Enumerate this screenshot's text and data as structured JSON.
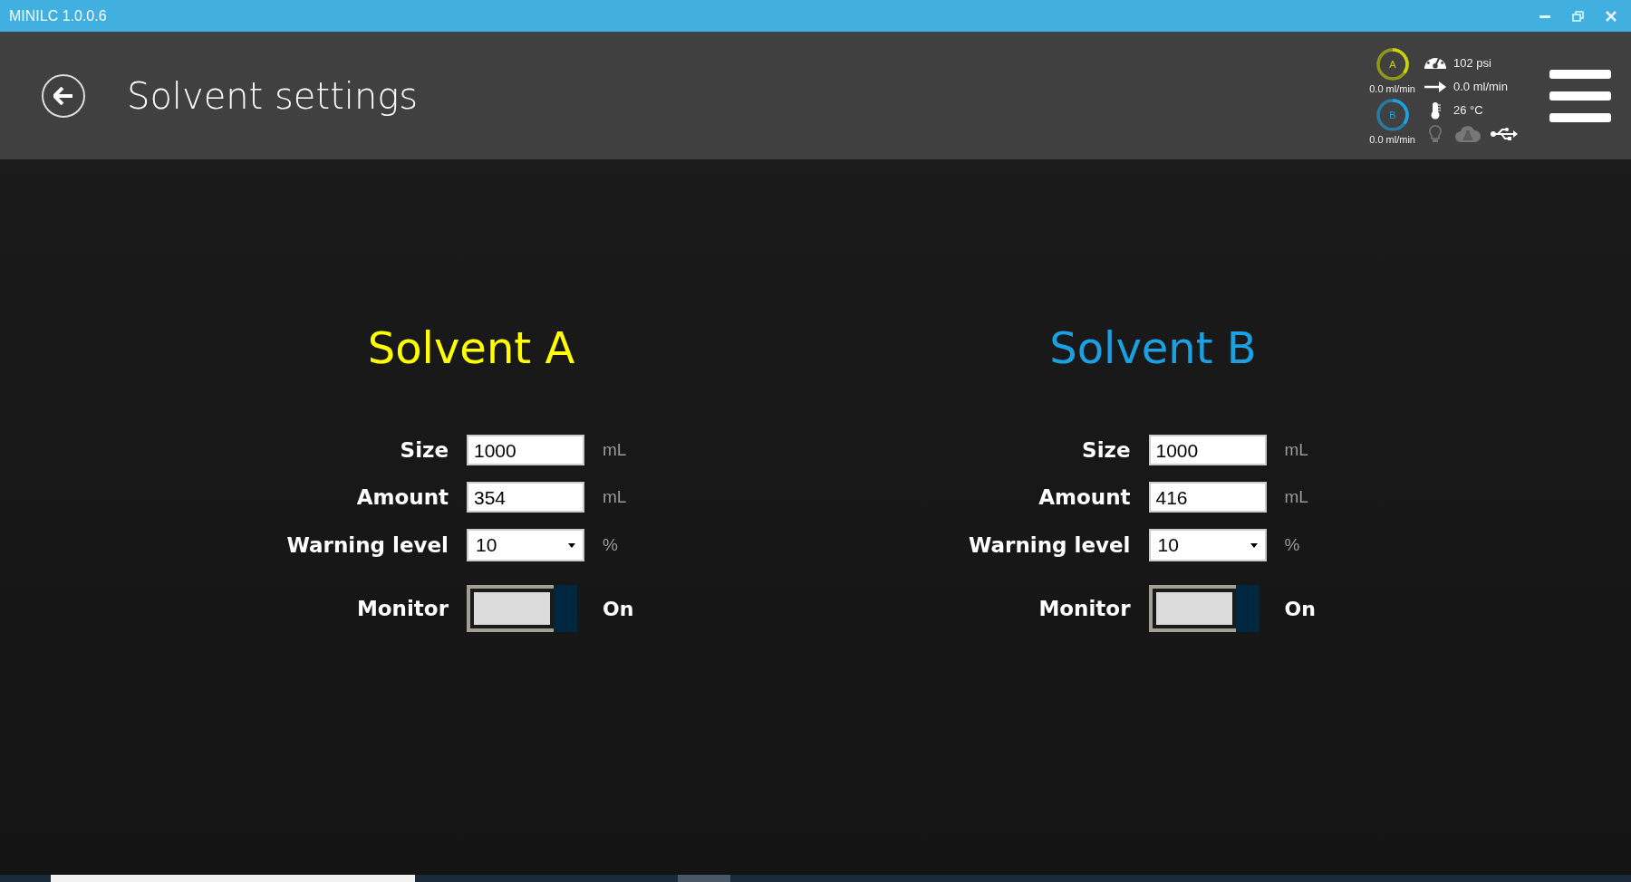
{
  "window": {
    "title": "MINILC 1.0.0.6"
  },
  "header": {
    "title": "Solvent settings"
  },
  "pumps": [
    {
      "label": "A",
      "flow": "0.0 ml/min",
      "color": "#c8d400"
    },
    {
      "label": "B",
      "flow": "0.0 ml/min",
      "color": "#1ba1e2"
    }
  ],
  "status": {
    "pressure": "102 psi",
    "flow": "0.0 ml/min",
    "temperature": "26 °C"
  },
  "indicators": [
    {
      "kind": "bulb",
      "on": false
    },
    {
      "kind": "cloud",
      "on": false
    },
    {
      "kind": "usb",
      "on": true
    }
  ],
  "solvents": [
    {
      "title": "Solvent A",
      "color": "#ffff00",
      "size": "1000",
      "size_unit": "mL",
      "amount": "354",
      "amount_unit": "mL",
      "warning_level": "10",
      "warning_unit": "%",
      "monitor_on": true,
      "monitor_text": "On",
      "labels": {
        "size": "Size",
        "amount": "Amount",
        "warning": "Warning level",
        "monitor": "Monitor"
      }
    },
    {
      "title": "Solvent B",
      "color": "#1ba1e2",
      "size": "1000",
      "size_unit": "mL",
      "amount": "416",
      "amount_unit": "mL",
      "warning_level": "10",
      "warning_unit": "%",
      "monitor_on": true,
      "monitor_text": "On",
      "labels": {
        "size": "Size",
        "amount": "Amount",
        "warning": "Warning level",
        "monitor": "Monitor"
      }
    }
  ]
}
